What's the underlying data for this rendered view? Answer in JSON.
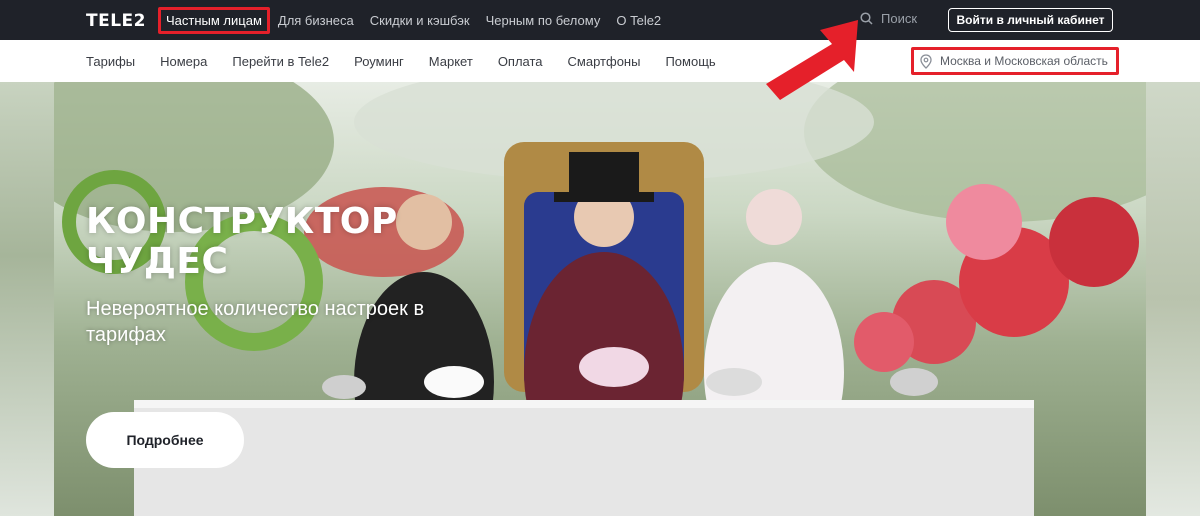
{
  "brand": {
    "logo_text": "TELE2",
    "accent": "#e5202a",
    "dark": "#1f2229"
  },
  "topnav": {
    "items": [
      {
        "label": "Частным лицам",
        "active": true
      },
      {
        "label": "Для бизнеса"
      },
      {
        "label": "Скидки и кэшбэк"
      },
      {
        "label": "Черным по белому"
      },
      {
        "label": "О Tele2"
      }
    ],
    "search_label": "Поиск",
    "search_icon": "search-icon",
    "login_label": "Войти в личный кабинет"
  },
  "subnav": {
    "items": [
      {
        "label": "Тарифы"
      },
      {
        "label": "Номера"
      },
      {
        "label": "Перейти в Tele2"
      },
      {
        "label": "Роуминг"
      },
      {
        "label": "Маркет"
      },
      {
        "label": "Оплата"
      },
      {
        "label": "Смартфоны"
      },
      {
        "label": "Помощь"
      }
    ],
    "region_label": "Москва и Московская область",
    "region_icon": "location-pin-icon"
  },
  "hero": {
    "title": "КОНСТРУКТОР ЧУДЕС",
    "subtitle": "Невероятное количество настроек в тарифах",
    "button_label": "Подробнее"
  }
}
